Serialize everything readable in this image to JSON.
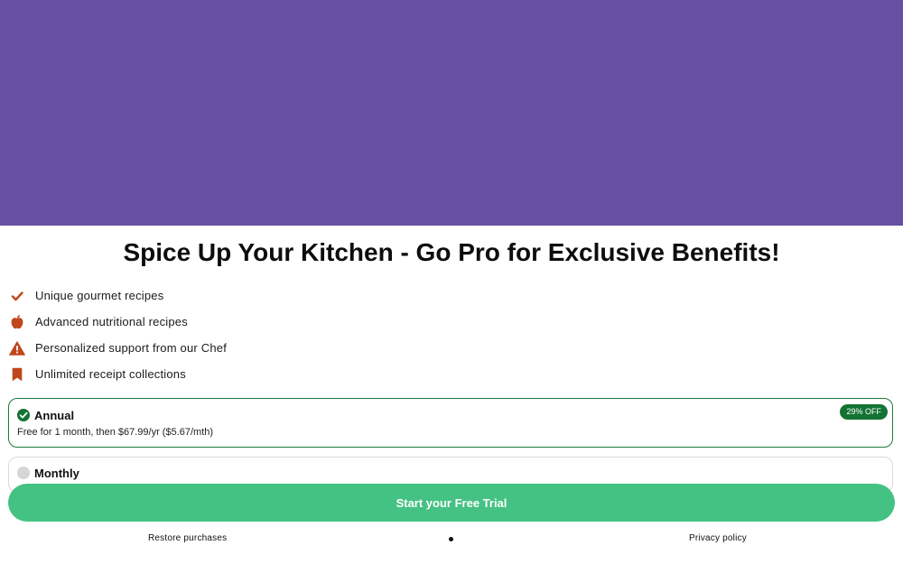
{
  "colors": {
    "hero_background": "#6750a4",
    "accent_icon": "#c0461b",
    "selected_plan": "#137333",
    "cta_background": "#44c283"
  },
  "title": "Spice Up Your Kitchen - Go Pro for Exclusive Benefits!",
  "features": [
    {
      "icon": "checkmark-icon",
      "label": "Unique gourmet recipes"
    },
    {
      "icon": "apple-icon",
      "label": "Advanced nutritional recipes"
    },
    {
      "icon": "warning-icon",
      "label": "Personalized support from our Chef"
    },
    {
      "icon": "bookmark-icon",
      "label": "Unlimited receipt collections"
    }
  ],
  "plans": {
    "annual": {
      "name": "Annual",
      "detail": "Free for 1 month, then $67.99/yr ($5.67/mth)",
      "badge": "29% OFF",
      "selected": true
    },
    "monthly": {
      "name": "Monthly",
      "selected": false
    }
  },
  "cta": {
    "label": "Start your Free Trial"
  },
  "footer": {
    "restore_label": "Restore purchases",
    "privacy_label": "Privacy policy"
  }
}
